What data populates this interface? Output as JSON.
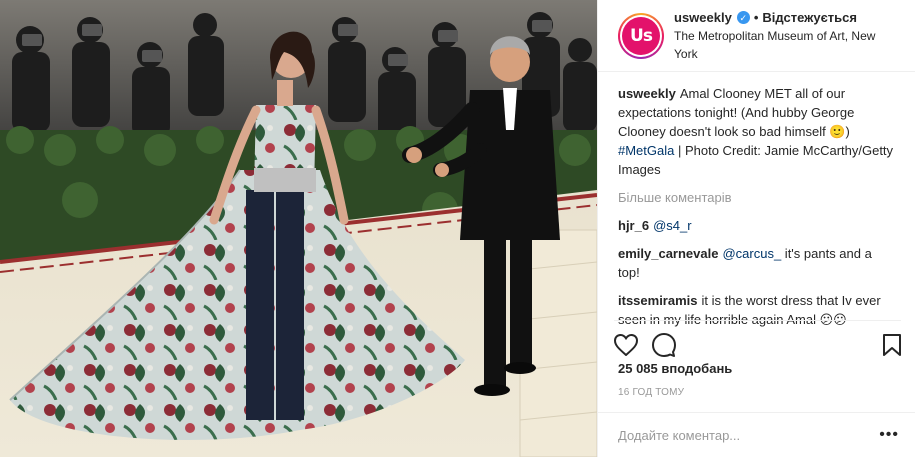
{
  "post": {
    "image_alt": "Amal Clooney and George Clooney on the red carpet",
    "account": {
      "username": "usweekly",
      "avatar_text": "Us",
      "verified_icon": "verified-badge-icon",
      "separator": "•",
      "follow_label": "Відстежується",
      "location": "The Metropolitan Museum of Art, New York"
    },
    "caption": {
      "username": "usweekly",
      "text_1": "Amal Clooney MET all of our expectations tonight! (And hubby George Clooney doesn't look so bad himself ",
      "emoji": "🙂",
      "text_2": ") ",
      "hashtag": "#MetGala",
      "text_3": " | Photo Credit: Jamie McCarthy/Getty Images"
    },
    "more_comments_label": "Більше коментарів",
    "comments": [
      {
        "username": "hjr_6",
        "mention": "@s4_r",
        "text": ""
      },
      {
        "username": "emily_carnevale",
        "mention": "@carcus_",
        "text": " it's pants and a top!"
      },
      {
        "username": "itssemiramis",
        "mention": "",
        "text": "it is the worst dress that Iv ever seen in my life horrible again Amal 😕😕"
      }
    ],
    "likes": "25 085 вподобань",
    "timestamp": "16 ГОД ТОМУ",
    "add_comment_placeholder": "Додайте коментар...",
    "more_options": "•••",
    "icons": [
      "heart-icon",
      "comment-icon",
      "bookmark-icon"
    ]
  }
}
